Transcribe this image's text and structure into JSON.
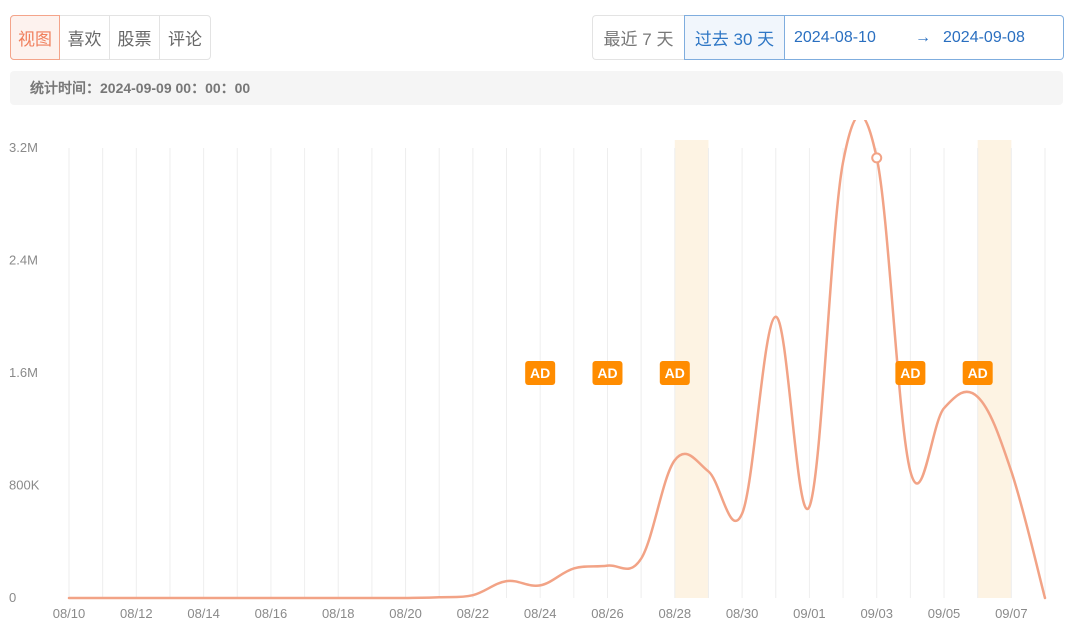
{
  "tabs": [
    {
      "label": "视图",
      "active": true
    },
    {
      "label": "喜欢",
      "active": false
    },
    {
      "label": "股票",
      "active": false
    },
    {
      "label": "评论",
      "active": false
    }
  ],
  "range": {
    "last7": "最近 7 天",
    "past30": "过去 30 天",
    "start": "2024-08-10",
    "arrow": "→",
    "end": "2024-09-08"
  },
  "stat": {
    "label": "统计时间：2024-09-09 00：00：00"
  },
  "colors": {
    "line": "#f2a386",
    "ad_badge": "#ff8c00",
    "ad_band": "#fdf3e3",
    "grid": "#eeeeee"
  },
  "chart_data": {
    "type": "line",
    "x": [
      "2024-08-10",
      "2024-08-11",
      "2024-08-12",
      "2024-08-13",
      "2024-08-14",
      "2024-08-15",
      "2024-08-16",
      "2024-08-17",
      "2024-08-18",
      "2024-08-19",
      "2024-08-20",
      "2024-08-21",
      "2024-08-22",
      "2024-08-23",
      "2024-08-24",
      "2024-08-25",
      "2024-08-26",
      "2024-08-27",
      "2024-08-28",
      "2024-08-29",
      "2024-08-30",
      "2024-08-31",
      "2024-09-01",
      "2024-09-02",
      "2024-09-03",
      "2024-09-04",
      "2024-09-05",
      "2024-09-06",
      "2024-09-07",
      "2024-09-08"
    ],
    "series": [
      {
        "values": [
          0,
          0,
          0,
          0,
          0,
          0,
          0,
          0,
          0,
          0,
          0,
          5000,
          20000,
          120000,
          90000,
          210000,
          230000,
          280000,
          980000,
          900000,
          600000,
          2000000,
          650000,
          3100000,
          3130000,
          900000,
          1350000,
          1430000,
          900000,
          0
        ]
      }
    ],
    "x_tick_labels": [
      "08/10",
      "08/12",
      "08/14",
      "08/16",
      "08/18",
      "08/20",
      "08/22",
      "08/24",
      "08/26",
      "08/28",
      "08/30",
      "09/01",
      "09/03",
      "09/05",
      "09/07"
    ],
    "y_tick_labels": [
      "0",
      "800K",
      "1.6M",
      "2.4M",
      "3.2M"
    ],
    "y_ticks": [
      0,
      800000,
      1600000,
      2400000,
      3200000
    ],
    "ylim": [
      0,
      3200000
    ],
    "grid": true,
    "ad_markers": [
      {
        "date": "2024-08-24",
        "label": "AD"
      },
      {
        "date": "2024-08-26",
        "label": "AD"
      },
      {
        "date": "2024-08-28",
        "label": "AD"
      },
      {
        "date": "2024-09-04",
        "label": "AD"
      },
      {
        "date": "2024-09-06",
        "label": "AD"
      }
    ],
    "ad_bands": [
      "2024-08-28",
      "2024-09-06"
    ],
    "highlight_point": "2024-09-03"
  }
}
